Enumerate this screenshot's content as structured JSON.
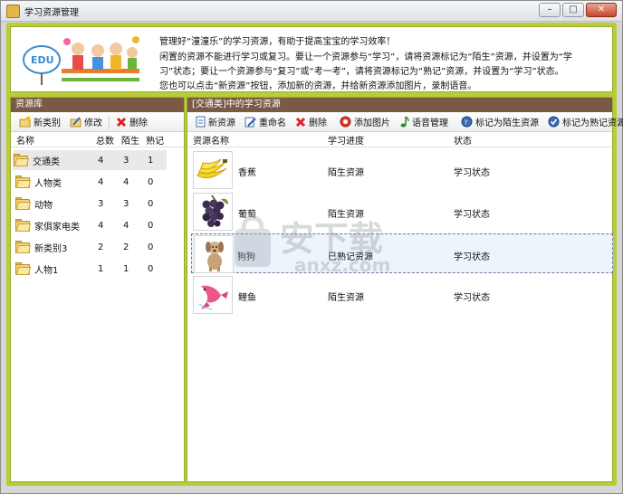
{
  "window": {
    "title": "学习资源管理",
    "minimize": "–",
    "maximize": "□",
    "close": "✕"
  },
  "banner": {
    "logo_text": "EDU",
    "line1": "管理好“潼潼乐”的学习资源，有助于提高宝宝的学习效率！",
    "line2": "闲置的资源不能进行学习或复习。要让一个资源参与“学习”，请将资源标记为“陌生”资源，并设置为“学",
    "line3": "习”状态；要让一个资源参与“复习”或“考一考”，请将资源标记为“熟记”资源，并设置为“学习”状态。",
    "line4": "您也可以点击“新资源”按钮，添加新的资源，并给新资源添加图片，录制语音。"
  },
  "left_panel": {
    "header": "资源库",
    "toolbar": {
      "new_category": "新类别",
      "edit": "修改",
      "delete": "删除"
    },
    "columns": {
      "name": "名称",
      "total": "总数",
      "unfamiliar": "陌生",
      "familiar": "熟记"
    },
    "rows": [
      {
        "name": "交通类",
        "total": "4",
        "unfamiliar": "3",
        "familiar": "1"
      },
      {
        "name": "人物类",
        "total": "4",
        "unfamiliar": "4",
        "familiar": "0"
      },
      {
        "name": "动物",
        "total": "3",
        "unfamiliar": "3",
        "familiar": "0"
      },
      {
        "name": "家俱家电类",
        "total": "4",
        "unfamiliar": "4",
        "familiar": "0"
      },
      {
        "name": "新类别3",
        "total": "2",
        "unfamiliar": "2",
        "familiar": "0"
      },
      {
        "name": "人物1",
        "total": "1",
        "unfamiliar": "1",
        "familiar": "0"
      }
    ]
  },
  "right_panel": {
    "header": "[交通类]中的学习资源",
    "toolbar": {
      "new_resource": "新资源",
      "rename": "重命名",
      "delete": "删除",
      "add_image": "添加图片",
      "voice_manage": "语音管理",
      "mark_unfamiliar": "标记为陌生资源",
      "mark_familiar": "标记为熟记资源"
    },
    "columns": {
      "name": "资源名称",
      "progress": "学习进度",
      "status": "状态"
    },
    "rows": [
      {
        "name": "香蕉",
        "progress": "陌生资源",
        "status": "学习状态",
        "image": "banana"
      },
      {
        "name": "葡萄",
        "progress": "陌生资源",
        "status": "学习状态",
        "image": "grapes"
      },
      {
        "name": "狗狗",
        "progress": "已熟记资源",
        "status": "学习状态",
        "image": "dog"
      },
      {
        "name": "鲤鱼",
        "progress": "陌生资源",
        "status": "学习状态",
        "image": "carp"
      }
    ]
  },
  "watermark": {
    "text_cn": "安下载",
    "text_en": "anxz.com"
  },
  "colors": {
    "frame_green": "#b9cc3a",
    "panel_header_brown": "#7b5a45",
    "selection_bg": "#eef4fc"
  }
}
